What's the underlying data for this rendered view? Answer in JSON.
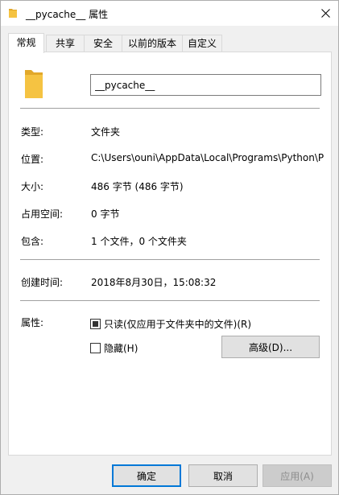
{
  "window": {
    "title": "__pycache__ 属性",
    "close_glyph": "✕"
  },
  "tabs": [
    {
      "label": "常规",
      "active": true
    },
    {
      "label": "共享",
      "active": false
    },
    {
      "label": "安全",
      "active": false
    },
    {
      "label": "以前的版本",
      "active": false
    },
    {
      "label": "自定义",
      "active": false
    }
  ],
  "general": {
    "folder_name": "__pycache__",
    "type_label": "类型:",
    "type_value": "文件夹",
    "location_label": "位置:",
    "location_value": "C:\\Users\\ouni\\AppData\\Local\\Programs\\Python\\P",
    "size_label": "大小:",
    "size_value": "486 字节 (486 字节)",
    "disk_label": "占用空间:",
    "disk_value": "0 字节",
    "contains_label": "包含:",
    "contains_value": "1 个文件，0 个文件夹",
    "created_label": "创建时间:",
    "created_value": "2018年8月30日，15:08:32",
    "attributes_label": "属性:",
    "readonly_label": "只读(仅应用于文件夹中的文件)(R)",
    "readonly_state": "indeterminate",
    "hidden_label": "隐藏(H)",
    "hidden_state": "unchecked",
    "advanced_button": "高级(D)..."
  },
  "footer": {
    "ok": "确定",
    "cancel": "取消",
    "apply": "应用(A)"
  },
  "colors": {
    "folder": "#f5c342",
    "folder_dark": "#e2a82a",
    "accent": "#0078d7"
  }
}
